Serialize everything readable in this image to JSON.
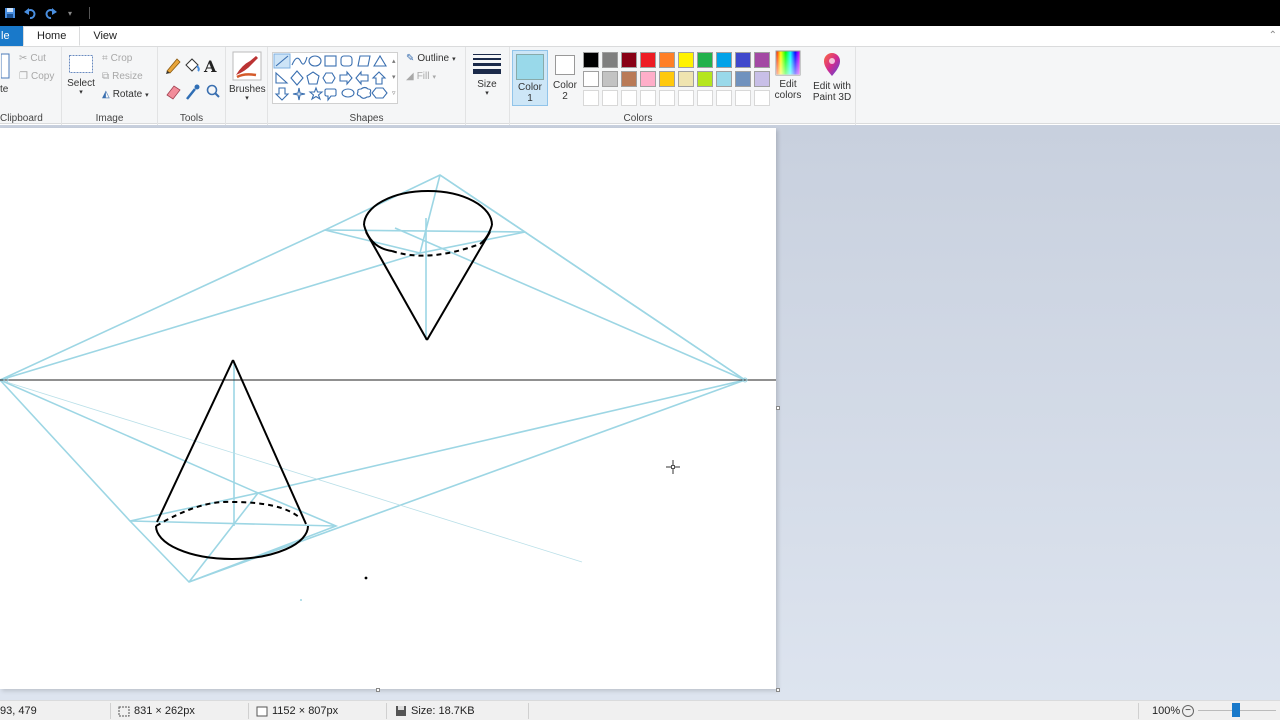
{
  "tabs": {
    "file": "le",
    "home": "Home",
    "view": "View"
  },
  "clipboard": {
    "paste": "te",
    "cut": "Cut",
    "copy": "Copy",
    "label": "Clipboard"
  },
  "image": {
    "select": "Select",
    "crop": "Crop",
    "resize": "Resize",
    "rotate": "Rotate",
    "label": "Image"
  },
  "tools": {
    "label": "Tools"
  },
  "brushes": {
    "label": "Brushes"
  },
  "shapes": {
    "outline": "Outline",
    "fill": "Fill",
    "label": "Shapes"
  },
  "size": {
    "label": "Size"
  },
  "colors": {
    "color1_line1": "Color",
    "color1_line2": "1",
    "color2_line1": "Color",
    "color2_line2": "2",
    "label": "Colors",
    "edit_line1": "Edit",
    "edit_line2": "colors",
    "paint3d_line1": "Edit with",
    "paint3d_line2": "Paint 3D",
    "color1_value": "#99d9ea",
    "color2_value": "#ffffff",
    "palette_row1": [
      "#000000",
      "#7f7f7f",
      "#880015",
      "#ed1c24",
      "#ff7f27",
      "#fff200",
      "#22b14c",
      "#00a2e8",
      "#3f48cc",
      "#a349a4"
    ],
    "palette_row2": [
      "#ffffff",
      "#c3c3c3",
      "#b97a57",
      "#ffaec9",
      "#ffc90e",
      "#efe4b0",
      "#b5e61d",
      "#99d9ea",
      "#7092be",
      "#c8bfe7"
    ]
  },
  "status": {
    "cursor": "93, 479",
    "selection": "831 × 262px",
    "canvas_size": "1152 × 807px",
    "file_size": "Size: 18.7KB",
    "zoom": "100%"
  }
}
